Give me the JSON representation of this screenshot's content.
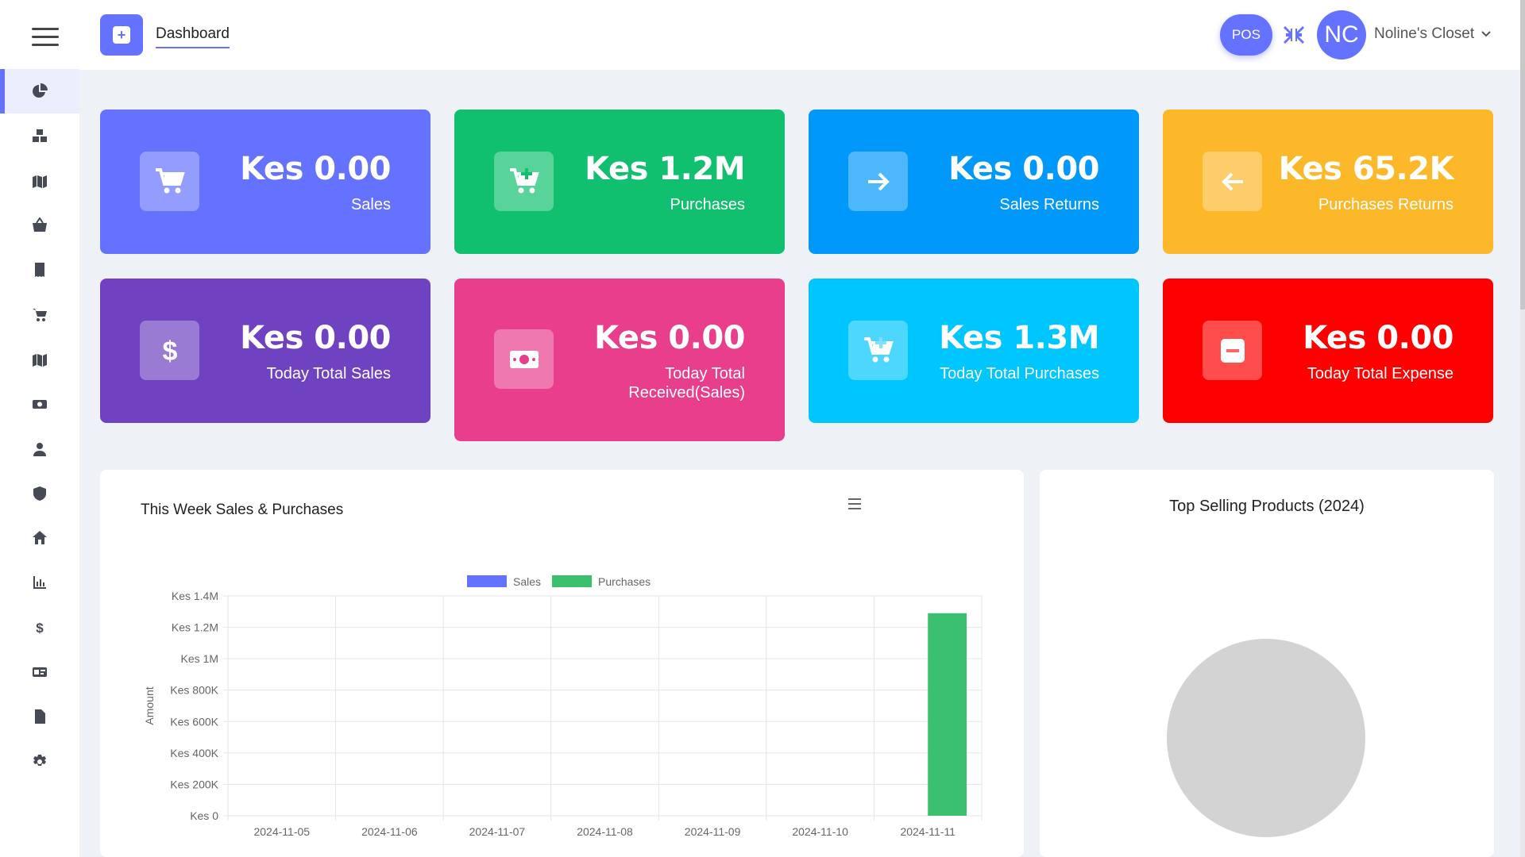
{
  "topbar": {
    "title": "Dashboard",
    "pos_label": "POS",
    "avatar_initials": "NC",
    "user_name": "Noline's Closet"
  },
  "sidebar": {
    "items": [
      {
        "icon": "pie-chart-icon",
        "active": true
      },
      {
        "icon": "boxes-icon"
      },
      {
        "icon": "map-icon"
      },
      {
        "icon": "basket-icon"
      },
      {
        "icon": "receipt-icon"
      },
      {
        "icon": "cart-icon"
      },
      {
        "icon": "map-icon"
      },
      {
        "icon": "money-icon"
      },
      {
        "icon": "user-icon"
      },
      {
        "icon": "shield-icon"
      },
      {
        "icon": "home-icon"
      },
      {
        "icon": "bar-chart-icon"
      },
      {
        "icon": "dollar-icon"
      },
      {
        "icon": "id-card-icon"
      },
      {
        "icon": "file-icon"
      },
      {
        "icon": "gear-icon"
      }
    ]
  },
  "cards": [
    {
      "value": "Kes 0.00",
      "label": "Sales",
      "color": "#6571ff",
      "icon": "cart-icon"
    },
    {
      "value": "Kes 1.2M",
      "label": "Purchases",
      "color": "#10c06f",
      "icon": "cart-plus-icon"
    },
    {
      "value": "Kes 0.00",
      "label": "Sales Returns",
      "color": "#0099fb",
      "icon": "arrow-right-icon"
    },
    {
      "value": "Kes 65.2K",
      "label": "Purchases Returns",
      "color": "#fdb82a",
      "icon": "arrow-left-icon"
    },
    {
      "value": "Kes 0.00",
      "label": "Today Total Sales",
      "color": "#6f42c1",
      "icon": "dollar-icon"
    },
    {
      "value": "Kes 0.00",
      "label_line1": "Today Total",
      "label_line2": "Received(Sales)",
      "color": "#e83e8c",
      "icon": "money-icon"
    },
    {
      "value": "Kes 1.3M",
      "label": "Today Total Purchases",
      "color": "#00c6ff",
      "icon": "cart-plus-icon"
    },
    {
      "value": "Kes 0.00",
      "label": "Today Total Expense",
      "color": "#ff0000",
      "icon": "minus-square-icon"
    }
  ],
  "weekly_panel": {
    "title": "This Week Sales & Purchases"
  },
  "top_panel": {
    "title": "Top Selling Products (2024)"
  },
  "chart_data": [
    {
      "type": "bar",
      "categories": [
        "2024-11-05",
        "2024-11-06",
        "2024-11-07",
        "2024-11-08",
        "2024-11-09",
        "2024-11-10",
        "2024-11-11"
      ],
      "series": [
        {
          "name": "Sales",
          "color": "#6571ff",
          "values": [
            0,
            0,
            0,
            0,
            0,
            0,
            0
          ]
        },
        {
          "name": "Purchases",
          "color": "#3bc06f",
          "values": [
            0,
            0,
            0,
            0,
            0,
            0,
            1290000
          ]
        }
      ],
      "ylabel": "Amount",
      "ylim": [
        0,
        1400000
      ],
      "yticks": [
        {
          "value": 0,
          "label": "Kes 0"
        },
        {
          "value": 200000,
          "label": "Kes 200K"
        },
        {
          "value": 400000,
          "label": "Kes 400K"
        },
        {
          "value": 600000,
          "label": "Kes 600K"
        },
        {
          "value": 800000,
          "label": "Kes 800K"
        },
        {
          "value": 1000000,
          "label": "Kes 1M"
        },
        {
          "value": 1200000,
          "label": "Kes 1.2M"
        },
        {
          "value": 1400000,
          "label": "Kes 1.4M"
        }
      ],
      "legend": "top",
      "grid": true
    },
    {
      "type": "pie",
      "values": [],
      "empty_color": "#d3d3d3"
    }
  ]
}
